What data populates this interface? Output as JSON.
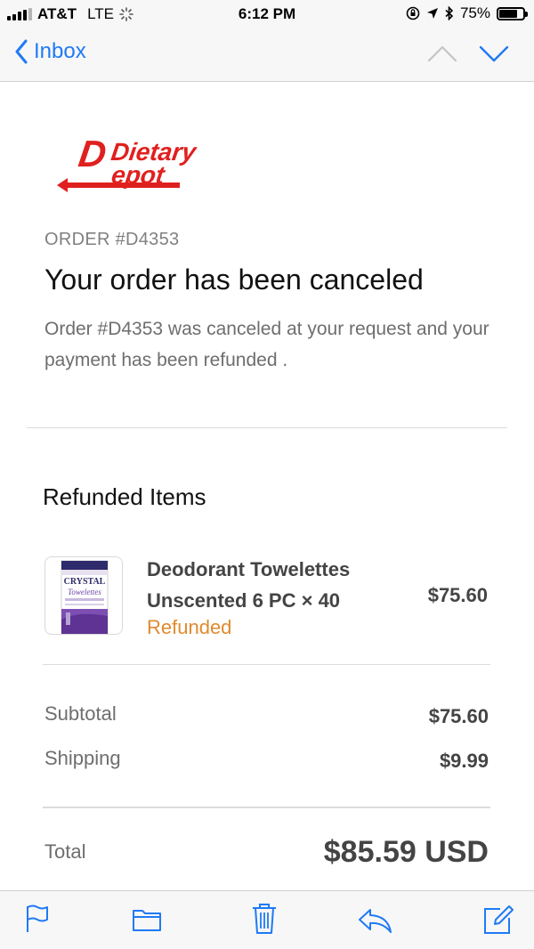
{
  "status_bar": {
    "carrier": "AT&T",
    "network": "LTE",
    "time": "6:12 PM",
    "battery_percent": "75%",
    "battery_level": 0.75
  },
  "nav": {
    "back_label": "Inbox",
    "accent_color": "#1f7af5"
  },
  "email": {
    "logo_text_line1": "Dietary",
    "logo_text_line2": "Depot",
    "order_label": "ORDER #D4353",
    "headline": "Your order has been canceled",
    "description": "Order #D4353 was canceled at your request and your payment has been refunded ."
  },
  "refunded": {
    "title": "Refunded Items",
    "items": [
      {
        "name": "Deodorant Towelettes Unscented 6 PC × 40",
        "status": "Refunded",
        "price": "$75.60",
        "thumb_brand": "CRYSTAL",
        "thumb_product": "Towelettes"
      }
    ]
  },
  "summary": {
    "subtotal_label": "Subtotal",
    "subtotal_value": "$75.60",
    "shipping_label": "Shipping",
    "shipping_value": "$9.99",
    "total_label": "Total",
    "total_value": "$85.59 USD"
  },
  "toolbar": {
    "icons": [
      "flag-icon",
      "folder-icon",
      "trash-icon",
      "reply-icon",
      "compose-icon"
    ]
  },
  "colors": {
    "brand_red": "#e0201f",
    "refunded_orange": "#e08a2e"
  }
}
